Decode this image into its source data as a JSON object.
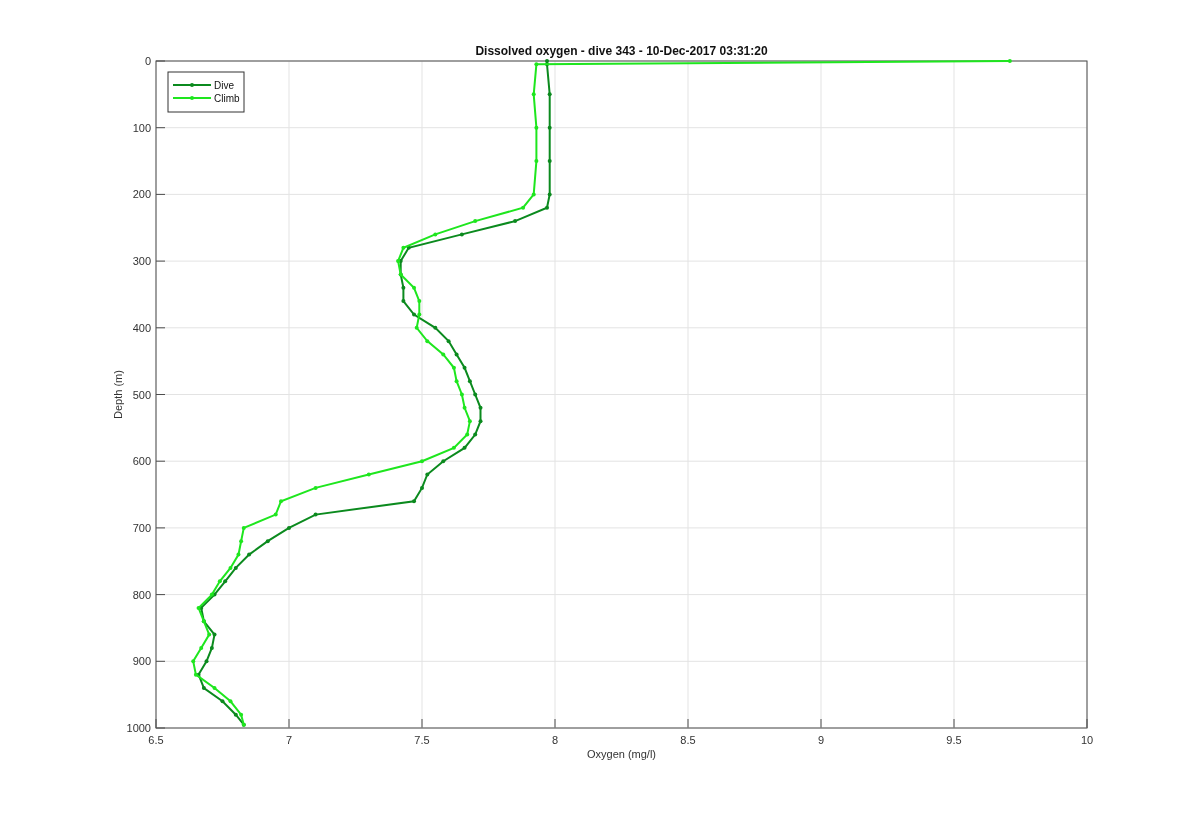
{
  "chart_data": {
    "type": "line",
    "orientation": "horizontal",
    "title": "Dissolved oxygen - dive 343 - 10-Dec-2017 03:31:20",
    "xlabel": "Oxygen (mg/l)",
    "ylabel": "Depth (m)",
    "x": [
      0,
      5,
      50,
      100,
      150,
      200,
      220,
      240,
      260,
      280,
      300,
      320,
      340,
      360,
      380,
      400,
      420,
      440,
      460,
      480,
      500,
      520,
      540,
      560,
      580,
      600,
      620,
      640,
      660,
      680,
      700,
      720,
      740,
      760,
      780,
      800,
      820,
      840,
      860,
      880,
      900,
      920,
      940,
      960,
      980,
      995
    ],
    "series": [
      {
        "name": "Dive",
        "color": "#0b8a1e",
        "values": [
          7.97,
          7.97,
          7.98,
          7.98,
          7.98,
          7.98,
          7.97,
          7.85,
          7.65,
          7.45,
          7.42,
          7.42,
          7.43,
          7.43,
          7.47,
          7.55,
          7.6,
          7.63,
          7.66,
          7.68,
          7.7,
          7.72,
          7.72,
          7.7,
          7.66,
          7.58,
          7.52,
          7.5,
          7.47,
          7.1,
          7.0,
          6.92,
          6.85,
          6.8,
          6.76,
          6.72,
          6.67,
          6.68,
          6.72,
          6.71,
          6.69,
          6.66,
          6.68,
          6.75,
          6.8,
          6.83
        ]
      },
      {
        "name": "Climb",
        "color": "#1ee61e",
        "values": [
          9.71,
          7.93,
          7.92,
          7.93,
          7.93,
          7.92,
          7.88,
          7.7,
          7.55,
          7.43,
          7.41,
          7.42,
          7.47,
          7.49,
          7.49,
          7.48,
          7.52,
          7.58,
          7.62,
          7.63,
          7.65,
          7.66,
          7.68,
          7.67,
          7.62,
          7.5,
          7.3,
          7.1,
          6.97,
          6.95,
          6.83,
          6.82,
          6.81,
          6.78,
          6.74,
          6.71,
          6.66,
          6.68,
          6.7,
          6.67,
          6.64,
          6.65,
          6.72,
          6.78,
          6.82,
          6.83
        ]
      }
    ],
    "xlim": [
      6.5,
      10
    ],
    "ylim": [
      1000,
      0
    ],
    "grid": true,
    "legend": true,
    "xticks": [
      6.5,
      7,
      7.5,
      8,
      8.5,
      9,
      9.5,
      10
    ],
    "yticks": [
      0,
      100,
      200,
      300,
      400,
      500,
      600,
      700,
      800,
      900,
      1000
    ]
  }
}
